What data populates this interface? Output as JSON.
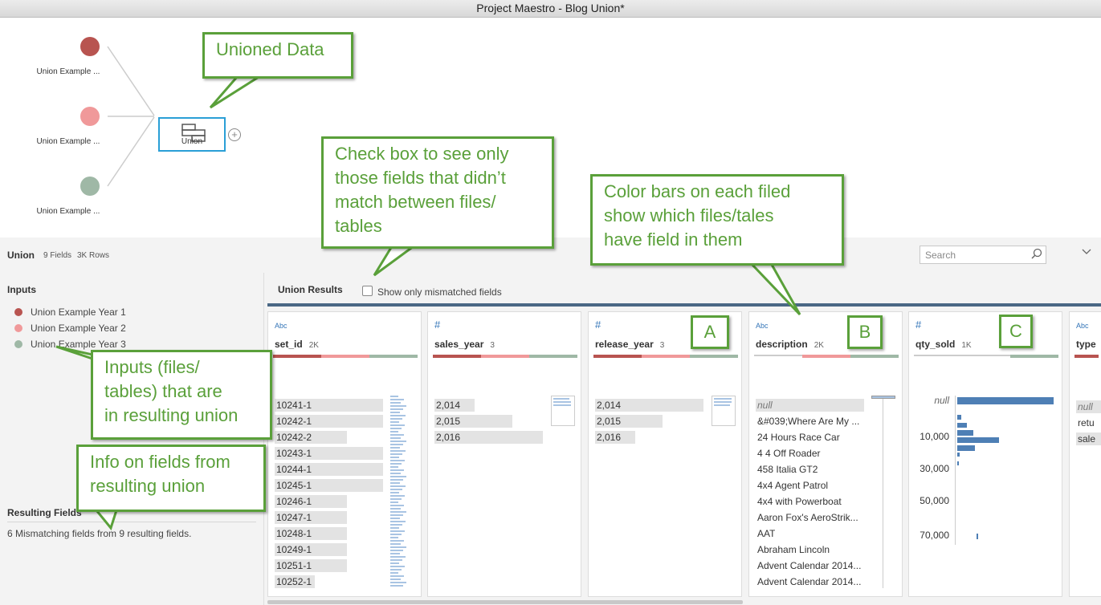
{
  "window": {
    "title": "Project Maestro - Blog Union*"
  },
  "flow": {
    "inputs": [
      {
        "label": "Union Example ...",
        "color": "#b85450"
      },
      {
        "label": "Union Example ...",
        "color": "#f0999a"
      },
      {
        "label": "Union Example ...",
        "color": "#9fb8a6"
      }
    ],
    "union_label": "Union",
    "add_symbol": "+"
  },
  "header": {
    "name": "Union",
    "fields": "9 Fields",
    "rows": "3K Rows",
    "search_placeholder": "Search",
    "collapse_icon": "chevron-down-icon"
  },
  "inputs": {
    "title": "Inputs",
    "items": [
      {
        "label": "Union Example Year 1",
        "color": "#b85450"
      },
      {
        "label": "Union Example Year 2",
        "color": "#f0999a"
      },
      {
        "label": "Union Example Year 3",
        "color": "#9fb8a6"
      }
    ]
  },
  "resulting": {
    "title": "Resulting Fields",
    "text": "6 Mismatching fields from 9 resulting fields."
  },
  "results": {
    "title": "Union Results",
    "checkbox_label": "Show only mismatched fields",
    "checkbox_checked": false
  },
  "cards": [
    {
      "type": "Abc",
      "name": "set_id",
      "count": "2K",
      "values": [
        "10241-1",
        "10242-1",
        "10242-2",
        "10243-1",
        "10244-1",
        "10245-1",
        "10246-1",
        "10247-1",
        "10248-1",
        "10249-1",
        "10251-1",
        "10252-1"
      ]
    },
    {
      "type": "#",
      "name": "sales_year",
      "count": "3",
      "values": [
        "2,014",
        "2,015",
        "2,016"
      ]
    },
    {
      "type": "#",
      "name": "release_year",
      "count": "3",
      "values": [
        "2,014",
        "2,015",
        "2,016"
      ]
    },
    {
      "type": "Abc",
      "name": "description",
      "count": "2K",
      "values": [
        "null",
        "&#039;Where Are My ...",
        "24 Hours Race Car",
        "4 4 Off Roader",
        "458 Italia GT2",
        "4x4 Agent Patrol",
        "4x4 with Powerboat",
        "Aaron Fox's AeroStrik...",
        "AAT",
        "Abraham Lincoln",
        "Advent Calendar 2014...",
        "Advent Calendar 2014..."
      ]
    },
    {
      "type": "#",
      "name": "qty_sold",
      "count": "1K",
      "axis": [
        "null",
        "10,000",
        "30,000",
        "50,000",
        "70,000"
      ]
    },
    {
      "type": "Abc",
      "name": "type",
      "count": "",
      "values": [
        "null",
        "retu",
        "sale"
      ]
    }
  ],
  "callouts": {
    "unioned": "Unioned Data",
    "checkbox": [
      "Check box to see only",
      "those fields that didn’t",
      "match between files/",
      "tables"
    ],
    "colorbars": [
      "Color bars on each filed",
      "show which files/tales",
      "have field in them"
    ],
    "inputs": [
      "Inputs (files/",
      "tables) that are",
      "in resulting union"
    ],
    "info": [
      "Info on fields from",
      "resulting union"
    ],
    "a": "A",
    "b": "B",
    "c": "C"
  },
  "colors": {
    "year1": "#b85450",
    "year2": "#f0999a",
    "year3": "#9fb8a6",
    "accent": "#2a9fd6",
    "callout": "#5aa03a",
    "bar": "#4e7fb5"
  }
}
